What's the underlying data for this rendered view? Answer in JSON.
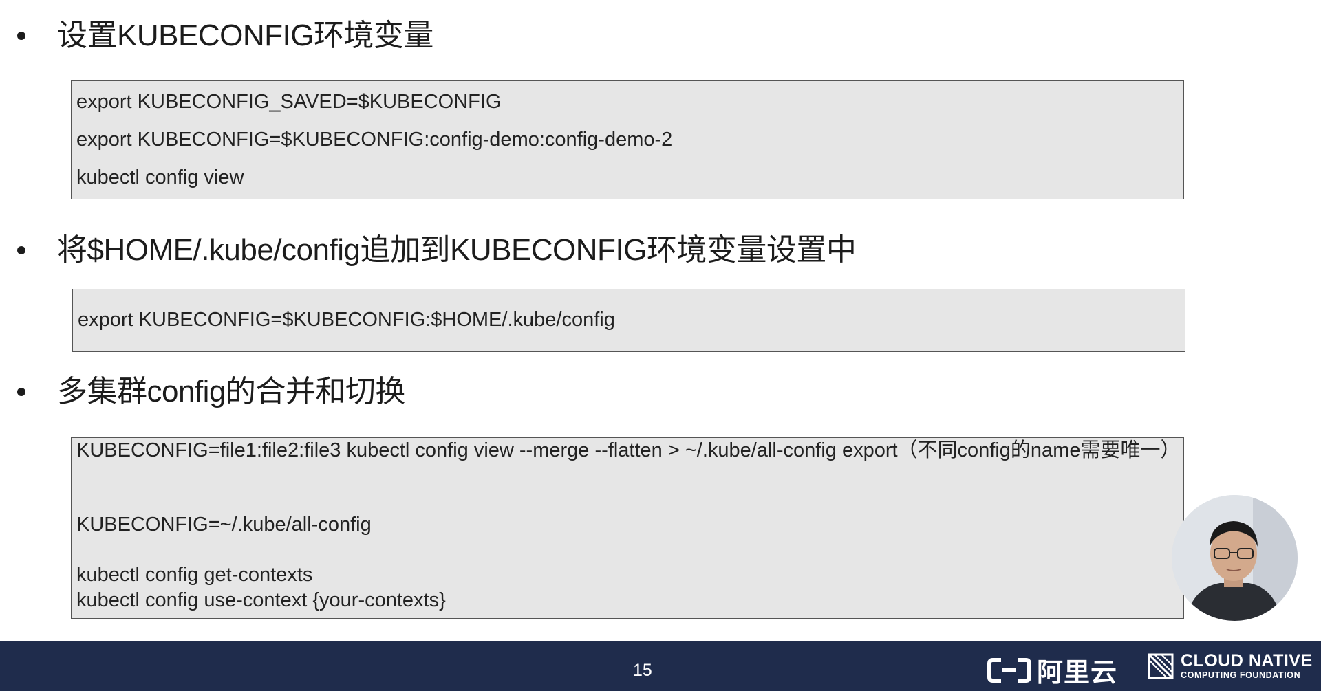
{
  "sections": [
    {
      "heading": "设置KUBECONFIG环境变量",
      "code_lines": [
        "export KUBECONFIG_SAVED=$KUBECONFIG",
        "export KUBECONFIG=$KUBECONFIG:config-demo:config-demo-2",
        "kubectl config view"
      ]
    },
    {
      "heading": "将$HOME/.kube/config追加到KUBECONFIG环境变量设置中",
      "code_lines": [
        "export KUBECONFIG=$KUBECONFIG:$HOME/.kube/config"
      ]
    },
    {
      "heading": "多集群config的合并和切换",
      "code_lines": [
        "KUBECONFIG=file1:file2:file3 kubectl config view --merge --flatten > ~/.kube/all-config export（不同config的name需要唯一）",
        "KUBECONFIG=~/.kube/all-config",
        "kubectl config get-contexts",
        "kubectl config use-context {your-contexts}"
      ]
    }
  ],
  "footer": {
    "page_number": "15",
    "aliyun_text": "阿里云",
    "cncf_line1": "CLOUD NATIVE",
    "cncf_line2": "COMPUTING FOUNDATION",
    "background_color": "#1f2c4c"
  },
  "icons": {
    "aliyun_logo": "aliyun-logo-icon",
    "cncf_logo": "cncf-logo-icon",
    "webcam": "presenter-webcam"
  },
  "colors": {
    "code_background": "#e6e6e6",
    "code_border": "#555555"
  }
}
